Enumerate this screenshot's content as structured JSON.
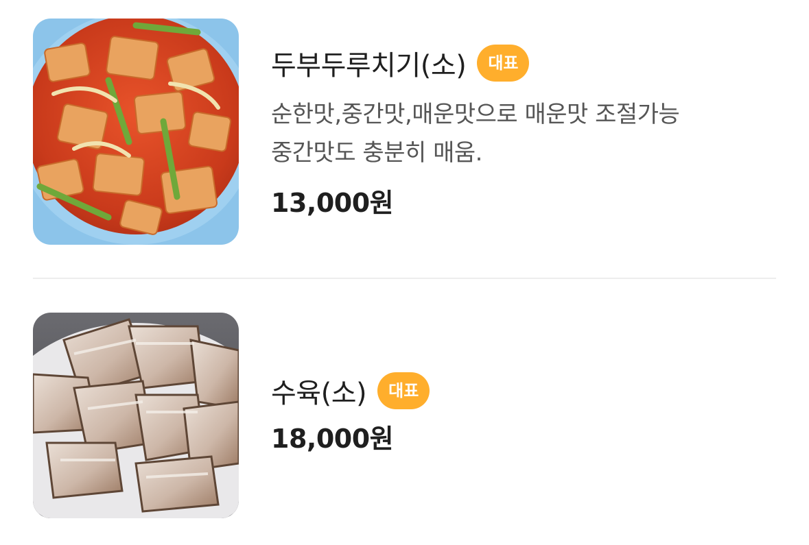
{
  "menu": {
    "items": [
      {
        "name": "두부두루치기(소)",
        "badge": "대표",
        "description_lines": [
          "순한맛,중간맛,매운맛으로 매운맛 조절가능",
          "중간맛도 충분히 매움."
        ],
        "price": "13,000원",
        "image": "spicy-braised-tofu-photo"
      },
      {
        "name": "수육(소)",
        "badge": "대표",
        "price": "18,000원",
        "image": "boiled-pork-slices-photo"
      }
    ]
  },
  "colors": {
    "badge": "#ffae2c",
    "text_primary": "#1f1f1f",
    "text_secondary": "#555555",
    "divider": "#ededed"
  }
}
